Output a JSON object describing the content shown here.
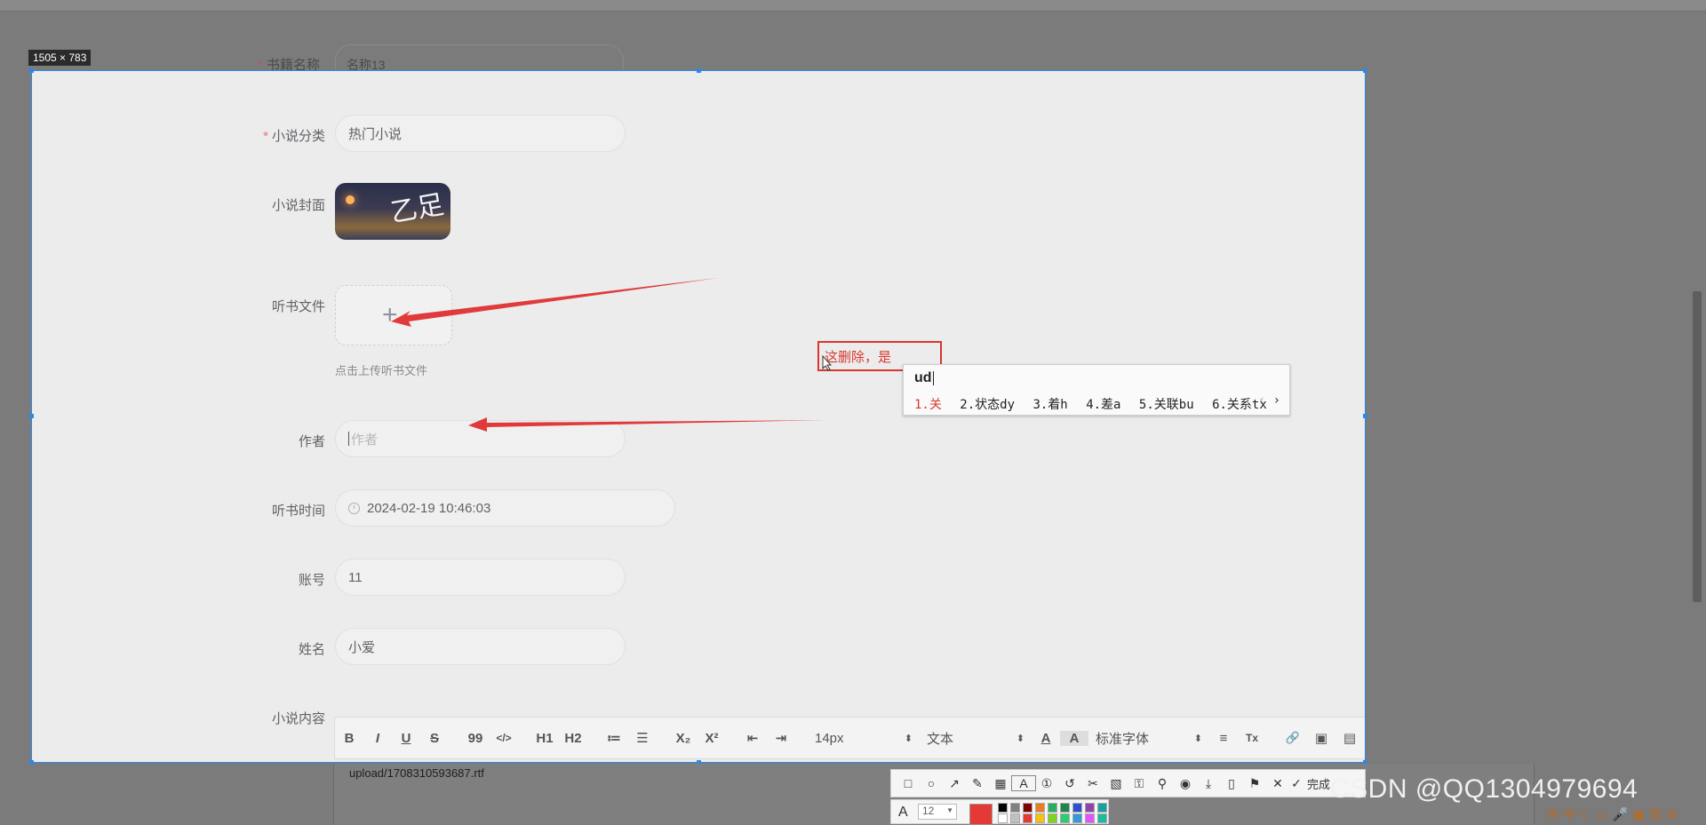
{
  "selection": {
    "size_label": "1505 × 783"
  },
  "form": {
    "book_name_label": "书籍名称",
    "book_name_value": "名称13",
    "category_label": "小说分类",
    "category_value": "热门小说",
    "cover_label": "小说封面",
    "audio_file_label": "听书文件",
    "upload_plus": "+",
    "upload_hint": "点击上传听书文件",
    "author_label": "作者",
    "author_placeholder": "作者",
    "listen_time_label": "听书时间",
    "listen_time_value": "2024-02-19 10:46:03",
    "account_label": "账号",
    "account_value": "11",
    "name_label": "姓名",
    "name_value": "小爱",
    "content_label": "小说内容",
    "required_mark": "*"
  },
  "editor": {
    "toolbar": {
      "bold": "B",
      "italic": "I",
      "underline": "U",
      "strike": "S",
      "quote": "99",
      "code": "</>",
      "h1": "H1",
      "h2": "H2",
      "ordered_list": "≔",
      "bullet_list": "☰",
      "subscript": "X₂",
      "superscript": "X²",
      "outdent": "⇤",
      "indent": "⇥",
      "font_size": "14px",
      "text_type": "文本",
      "font_color": "A",
      "background_color": "A",
      "font_family": "标准字体",
      "align": "≡",
      "clear_format": "Tx",
      "link": "🔗",
      "image": "▣",
      "video": "▤",
      "select_arrows": "⬍"
    },
    "content": "upload/1708310593687.rtf"
  },
  "annotation": {
    "note_text": "这删除，是",
    "arrow_color": "#e03a3a"
  },
  "ime": {
    "composition": "ud",
    "candidates": [
      "1.关",
      "2.状态dy",
      "3.着h",
      "4.差a",
      "5.关联bu",
      "6.关系tx"
    ],
    "prev": "‹",
    "next": "›"
  },
  "screenshot_tool": {
    "icons": [
      "rectangle-icon",
      "ellipse-icon",
      "arrow-icon",
      "pen-icon",
      "mosaic-icon",
      "text-icon",
      "serial-number-icon",
      "undo-icon",
      "pin-icon",
      "ocr-icon",
      "translate-icon",
      "top-icon",
      "record-icon",
      "save-icon",
      "long-screenshot-icon",
      "bookmark-icon",
      "close-icon",
      "done-icon"
    ],
    "icon_glyphs": [
      "□",
      "○",
      "↗",
      "✎",
      "▦",
      "A",
      "①",
      "↺",
      "✂",
      "▧",
      "⚿",
      "⚲",
      "◉",
      "⤓",
      "▯",
      "⚑",
      "✕",
      "✓"
    ],
    "done_label": "完成",
    "font_size": "12",
    "current_color": "#e53935",
    "swatches": [
      "#000000",
      "#808080",
      "#800000",
      "#e67e22",
      "#27ae60",
      "#1e8449",
      "#2e4fd1",
      "#8e44ad",
      "#16a0a0",
      "#ffffff",
      "#c0c0c0",
      "#e53935",
      "#f1c40f",
      "#7ed321",
      "#2ecc71",
      "#3498db",
      "#e056fd",
      "#1abc9c"
    ]
  },
  "watermark": "CSDN @QQ1304979694",
  "tray": "㊥ 中 ☾ ▭ 🎤 ▣ 简 ⚙"
}
